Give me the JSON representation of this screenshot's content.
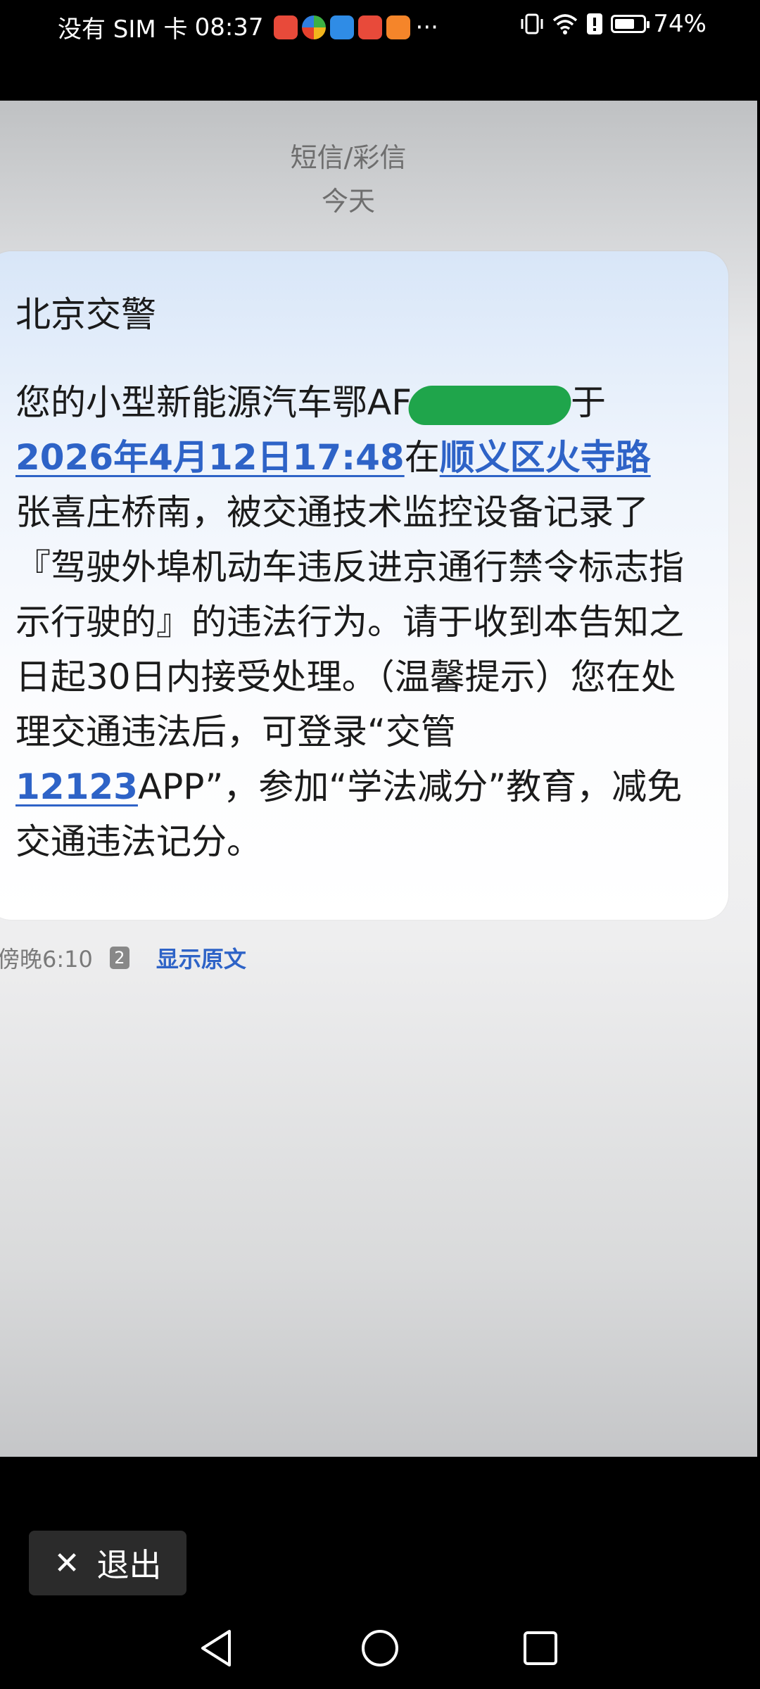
{
  "status_bar": {
    "carrier": "没有 SIM 卡",
    "time": "08:37",
    "more": "···",
    "battery_percent": "74%",
    "battery_level": 0.74
  },
  "thread": {
    "type_label": "短信/彩信",
    "day_label": "今天"
  },
  "message": {
    "sender": "北京交警",
    "body_part1": "您的小型新能源汽车鄂AF",
    "body_part2": "于",
    "date_link": "2026年4月12日17:48",
    "text_at": "在",
    "place_link": "顺义区火寺路",
    "body_part3": "张喜庄桥南，被交通技术监控设备记录了『驾驶外埠机动车违反进京通行禁令标志指示行驶的』的违法行为。请于收到本告知之日起30日内接受处理。（温馨提示）您在处理交通违法后，可登录“交管",
    "app_number_link": "12123",
    "body_part4": "APP”，参加“学法减分”教育，减免交通违法记分。",
    "timestamp": "傍晚6:10",
    "sim_badge": "2",
    "show_original": "显示原文"
  },
  "exit_button": {
    "label": "退出"
  },
  "colors": {
    "link": "#2e63c7",
    "redaction": "#1fa54b",
    "bubble_top": "#d8e6f8"
  }
}
